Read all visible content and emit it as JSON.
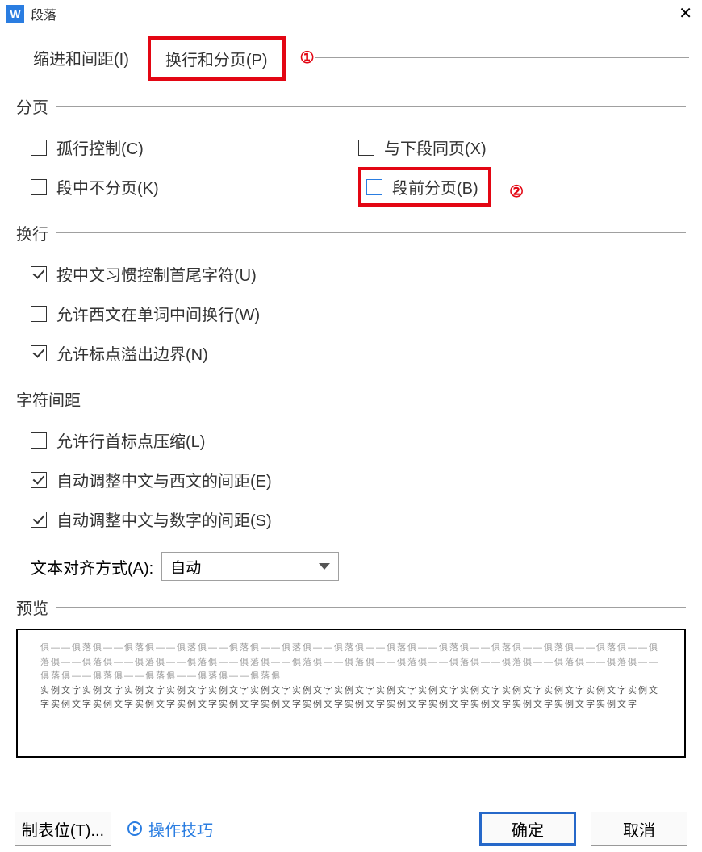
{
  "title": "段落",
  "tabs": {
    "indent": "缩进和间距(I)",
    "page": "换行和分页(P)"
  },
  "annotations": {
    "a1": "①",
    "a2": "②"
  },
  "sections": {
    "paging": {
      "legend": "分页",
      "orphan": "孤行控制(C)",
      "keepWithNext": "与下段同页(X)",
      "keepLines": "段中不分页(K)",
      "pageBreakBefore": "段前分页(B)"
    },
    "wrap": {
      "legend": "换行",
      "cjkFirstLast": "按中文习惯控制首尾字符(U)",
      "latinWrap": "允许西文在单词中间换行(W)",
      "punctOverflow": "允许标点溢出边界(N)"
    },
    "spacing": {
      "legend": "字符间距",
      "compressStartPunct": "允许行首标点压缩(L)",
      "autoCJKLatin": "自动调整中文与西文的间距(E)",
      "autoCJKDigit": "自动调整中文与数字的间距(S)",
      "alignLabel": "文本对齐方式(A):",
      "alignValue": "自动"
    },
    "preview": {
      "legend": "预览",
      "grey": "俱——俱落俱——俱落俱——俱落俱——俱落俱——俱落俱——俱落俱——俱落俱——俱落俱——俱落俱——俱落俱——俱落俱——俱落俱——俱落俱——俱落俱——俱落俱——俱落俱——俱落俱——俱落俱——俱落俱——俱落俱——俱落俱——俱落俱——俱落俱——俱落俱——俱落俱——俱落俱——俱落俱——俱落俱",
      "dark": "实例文字实例文字实例文字实例文字实例文字实例文字实例文字实例文字实例文字实例文字实例文字实例文字实例文字实例文字实例文字实例文字实例文字实例文字实例文字实例文字实例文字实例文字实例文字实例文字实例文字实例文字实例文字实例文字实例文字"
    }
  },
  "footer": {
    "tabstops": "制表位(T)...",
    "tips": "操作技巧",
    "ok": "确定",
    "cancel": "取消"
  }
}
